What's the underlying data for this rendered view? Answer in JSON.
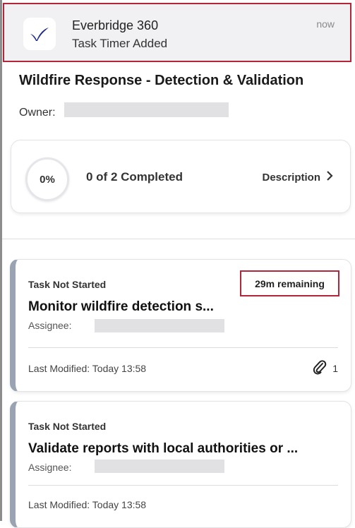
{
  "notification": {
    "app_name": "Everbridge 360",
    "message": "Task Timer Added",
    "time": "now",
    "logo_icon": "everbridge-check-logo",
    "logo_color": "#1b2a8c",
    "highlight_color": "#b3263a"
  },
  "incident": {
    "title": "Wildfire Response - Detection & Validation",
    "owner_label": "Owner:"
  },
  "progress": {
    "percent_text": "0%",
    "completed_text": "0 of 2 Completed",
    "description_label": "Description",
    "chevron_icon": "chevron-right-icon"
  },
  "tasks": [
    {
      "status": "Task Not Started",
      "timer": "29m remaining",
      "name": "Monitor wildfire detection s...",
      "assignee_label": "Assignee:",
      "modified": "Last Modified: Today 13:58",
      "attachments": "1",
      "attachment_icon": "paperclip-icon"
    },
    {
      "status": "Task Not Started",
      "name": "Validate reports with local authorities or ...",
      "assignee_label": "Assignee:",
      "modified": "Last Modified: Today 13:58"
    }
  ]
}
